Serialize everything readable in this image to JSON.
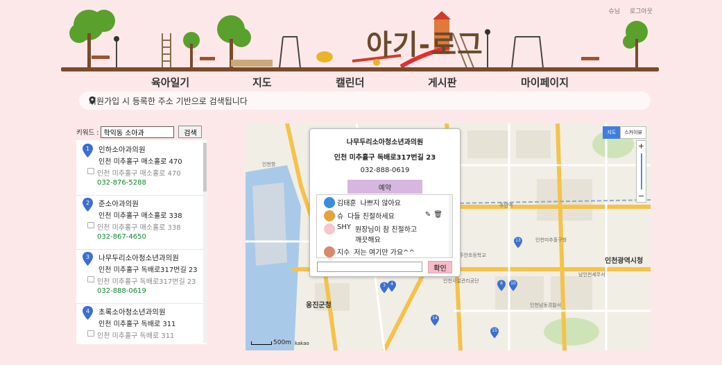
{
  "user_links": {
    "user": "슈님",
    "logout": "로그아웃"
  },
  "logo": {
    "title": "아기-로그"
  },
  "nav": {
    "items": [
      "육아일기",
      "지도",
      "캘린더",
      "게시판",
      "마이페이지"
    ]
  },
  "notice": {
    "text": "회원가입 시 등록한 주소 기반으로 검색됩니다"
  },
  "search": {
    "label": "키워드 :",
    "value": "학익동 소아과",
    "button": "검색"
  },
  "results": [
    {
      "num": "1",
      "name": "인하소아과의원",
      "road": "인천 미추홀구 매소홀로 470",
      "jibun": "인천 미추홀구 매소홀로 470",
      "phone": "032-876-5288"
    },
    {
      "num": "2",
      "name": "준소아과의원",
      "road": "인천 미추홀구 매소홀로 338",
      "jibun": "인천 미추홀구 매소홀로 338",
      "phone": "032-867-4650"
    },
    {
      "num": "3",
      "name": "나무두리소아청소년과의원",
      "road": "인천 미추홀구 독배로317번길 23",
      "jibun": "인천 미추홀구 독배로317번길 23",
      "phone": "032-888-0619"
    },
    {
      "num": "4",
      "name": "초록소아청소년과의원",
      "road": "인천 미추홀구 독배로 311",
      "jibun": "인천 미추홀구 독배로 311",
      "phone": ""
    }
  ],
  "map": {
    "type_buttons": [
      "지도",
      "스카이뷰"
    ],
    "zoom_in": "+",
    "zoom_out": "−",
    "scale": "500m",
    "provider": "kakao",
    "labels": [
      "인천광역시청",
      "옹진군청",
      "주안역",
      "인천남동경찰서",
      "남인천세무서",
      "인천시설관리공단",
      "주안초등학교",
      "인천미추홀구청"
    ],
    "pins": [
      "1",
      "2",
      "3",
      "4",
      "6",
      "10",
      "13",
      "14",
      "15"
    ]
  },
  "popup": {
    "name": "나무두리소아청소년과의원",
    "address": "인천 미추홀구 독배로317번길 23",
    "phone": "032-888-0619",
    "reserve": "예약",
    "comments": [
      {
        "author": "김태훈",
        "text": "나쁘지 않아요",
        "avatar": "blue"
      },
      {
        "author": "슈",
        "text": "다들 친절하세요",
        "avatar": "lion",
        "tools": true
      },
      {
        "author": "SHY",
        "text": "원장님이 참 친절하고 깨끗해요",
        "avatar": "pink"
      },
      {
        "author": "지수",
        "text": "저는 여기만 가요^^",
        "avatar": "bear"
      }
    ],
    "confirm": "확인"
  },
  "colors": {
    "background": "#fde8e9",
    "reserve": "#d7b7e0",
    "confirm": "#f3bcc7",
    "phone": "#0a8a2a",
    "marker": "#3b6fd0"
  }
}
